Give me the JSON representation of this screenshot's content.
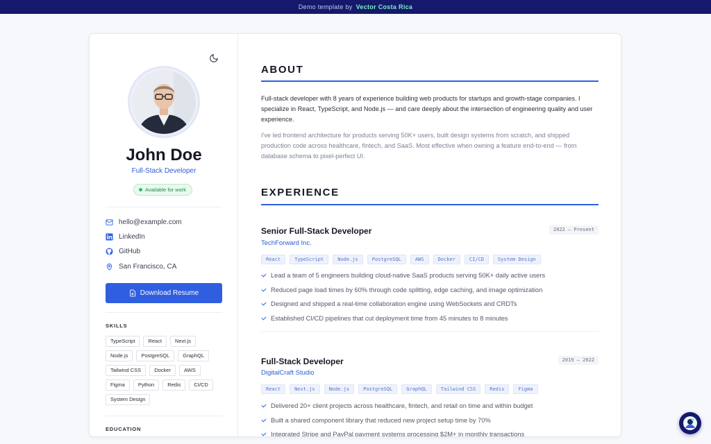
{
  "banner": {
    "prefix": "Demo template by",
    "brand": "Vector Costa Rica"
  },
  "profile": {
    "name": "John Doe",
    "role": "Full-Stack Developer",
    "status": "Available for work"
  },
  "contacts": [
    {
      "icon": "mail-icon",
      "label": "hello@example.com"
    },
    {
      "icon": "linkedin-icon",
      "label": "LinkedIn"
    },
    {
      "icon": "github-icon",
      "label": "GitHub"
    },
    {
      "icon": "location-pin-icon",
      "label": "San Francisco, CA"
    }
  ],
  "download_label": "Download Resume",
  "skills_heading": "SKILLS",
  "skills": [
    "TypeScript",
    "React",
    "Next.js",
    "Node.js",
    "PostgreSQL",
    "GraphQL",
    "Tailwind CSS",
    "Docker",
    "AWS",
    "Figma",
    "Python",
    "Redis",
    "CI/CD",
    "System Design"
  ],
  "education_heading": "EDUCATION",
  "about": {
    "heading": "ABOUT",
    "p1": "Full-stack developer with 8 years of experience building web products for startups and growth-stage companies. I specialize in React, TypeScript, and Node.js — and care deeply about the intersection of engineering quality and user experience.",
    "p2": "I've led frontend architecture for products serving 50K+ users, built design systems from scratch, and shipped production code across healthcare, fintech, and SaaS. Most effective when owning a feature end-to-end — from database schema to pixel-perfect UI."
  },
  "experience": {
    "heading": "EXPERIENCE",
    "jobs": [
      {
        "title": "Senior Full-Stack Developer",
        "dates": "2022 — Present",
        "company": "TechForward Inc.",
        "tags": [
          "React",
          "TypeScript",
          "Node.js",
          "PostgreSQL",
          "AWS",
          "Docker",
          "CI/CD",
          "System Design"
        ],
        "bullets": [
          "Lead a team of 5 engineers building cloud-native SaaS products serving 50K+ daily active users",
          "Reduced page load times by 60% through code splitting, edge caching, and image optimization",
          "Designed and shipped a real-time collaboration engine using WebSockets and CRDTs",
          "Established CI/CD pipelines that cut deployment time from 45 minutes to 8 minutes"
        ]
      },
      {
        "title": "Full-Stack Developer",
        "dates": "2019 — 2022",
        "company": "DigitalCraft Studio",
        "tags": [
          "React",
          "Next.js",
          "Node.js",
          "PostgreSQL",
          "GraphQL",
          "Tailwind CSS",
          "Redis",
          "Figma"
        ],
        "bullets": [
          "Delivered 20+ client projects across healthcare, fintech, and retail on time and within budget",
          "Built a shared component library that reduced new project setup time by 70%",
          "Integrated Stripe and PayPal payment systems processing $2M+ in monthly transactions"
        ]
      }
    ]
  },
  "colors": {
    "accent": "#2f5fe0",
    "banner": "#14196b",
    "brand": "#7cf3c0",
    "available": "#2fbf5f"
  }
}
